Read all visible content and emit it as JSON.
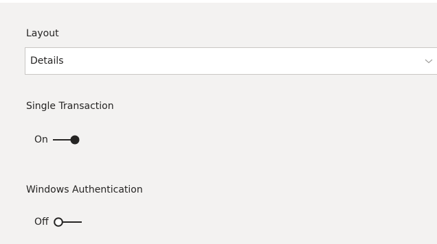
{
  "layout": {
    "label": "Layout",
    "selected": "Details",
    "chevron_icon": "chevron-down-icon"
  },
  "single_transaction": {
    "label": "Single Transaction",
    "state_text": "On",
    "on": true
  },
  "windows_authentication": {
    "label": "Windows Authentication",
    "state_text": "Off",
    "on": false
  },
  "colors": {
    "background": "#f3f2f1",
    "control_border": "#c8c6c4",
    "toggle": "#252423"
  }
}
